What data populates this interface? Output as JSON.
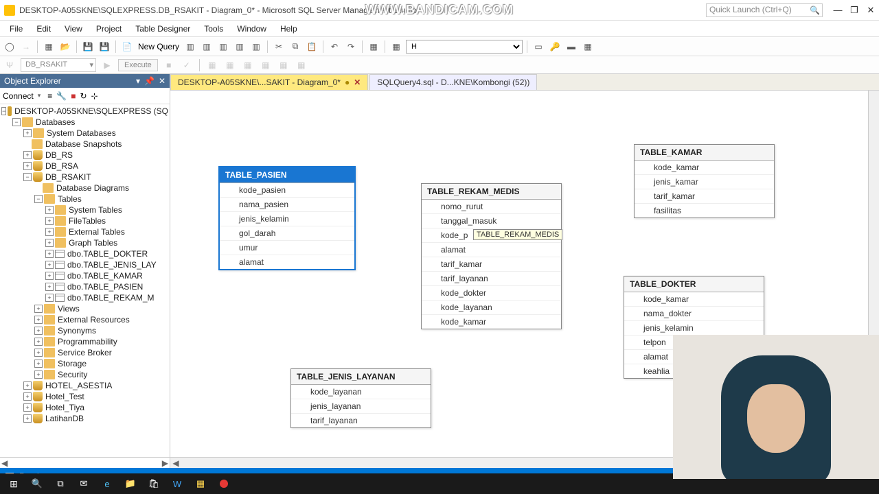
{
  "window": {
    "title": "DESKTOP-A05SKNE\\SQLEXPRESS.DB_RSAKIT - Diagram_0* - Microsoft SQL Server Management Studio",
    "quick_launch": "Quick Launch (Ctrl+Q)"
  },
  "watermark": "WWW.BANDICAM.COM",
  "menu": [
    "File",
    "Edit",
    "View",
    "Project",
    "Table Designer",
    "Tools",
    "Window",
    "Help"
  ],
  "toolbar": {
    "new_query": "New Query",
    "combo": "H"
  },
  "toolbar2": {
    "db": "DB_RSAKIT",
    "execute": "Execute"
  },
  "oe": {
    "title": "Object Explorer",
    "connect": "Connect"
  },
  "tree": {
    "server": "DESKTOP-A05SKNE\\SQLEXPRESS (SQ",
    "databases": "Databases",
    "sysdb": "System Databases",
    "snapshots": "Database Snapshots",
    "dbs": [
      "DB_RS",
      "DB_RSA",
      "DB_RSAKIT"
    ],
    "rsakit": {
      "dd": "Database Diagrams",
      "tables": "Tables",
      "systables": "System Tables",
      "filetables": "FileTables",
      "exttables": "External Tables",
      "graphtables": "Graph Tables",
      "t": [
        "dbo.TABLE_DOKTER",
        "dbo.TABLE_JENIS_LAY",
        "dbo.TABLE_KAMAR",
        "dbo.TABLE_PASIEN",
        "dbo.TABLE_REKAM_M"
      ],
      "views": "Views",
      "extres": "External Resources",
      "syn": "Synonyms",
      "prog": "Programmability",
      "sb": "Service Broker",
      "stor": "Storage",
      "sec": "Security"
    },
    "others": [
      "HOTEL_ASESTIA",
      "Hotel_Test",
      "Hotel_Tiya",
      "LatihanDB"
    ]
  },
  "tabs": {
    "t1": "DESKTOP-A05SKNE\\...SAKIT - Diagram_0*",
    "t2": "SQLQuery4.sql - D...KNE\\Kombongi (52))"
  },
  "diagram": {
    "pasien": {
      "title": "TABLE_PASIEN",
      "cols": [
        "kode_pasien",
        "nama_pasien",
        "jenis_kelamin",
        "gol_darah",
        "umur",
        "alamat"
      ]
    },
    "rekam": {
      "title": "TABLE_REKAM_MEDIS",
      "cols": [
        "nomo_rurut",
        "tanggal_masuk",
        "kode_p",
        "alamat",
        "tarif_kamar",
        "tarif_layanan",
        "kode_dokter",
        "kode_layanan",
        "kode_kamar"
      ],
      "tooltip": "TABLE_REKAM_MEDIS"
    },
    "kamar": {
      "title": "TABLE_KAMAR",
      "cols": [
        "kode_kamar",
        "jenis_kamar",
        "tarif_kamar",
        "fasilitas"
      ]
    },
    "dokter": {
      "title": "TABLE_DOKTER",
      "cols": [
        "kode_kamar",
        "nama_dokter",
        "jenis_kelamin",
        "telpon",
        "alamat",
        "keahlia"
      ]
    },
    "layanan": {
      "title": "TABLE_JENIS_LAYANAN",
      "cols": [
        "kode_layanan",
        "jenis_layanan",
        "tarif_layanan"
      ]
    }
  },
  "status": {
    "ready": "Ready"
  }
}
